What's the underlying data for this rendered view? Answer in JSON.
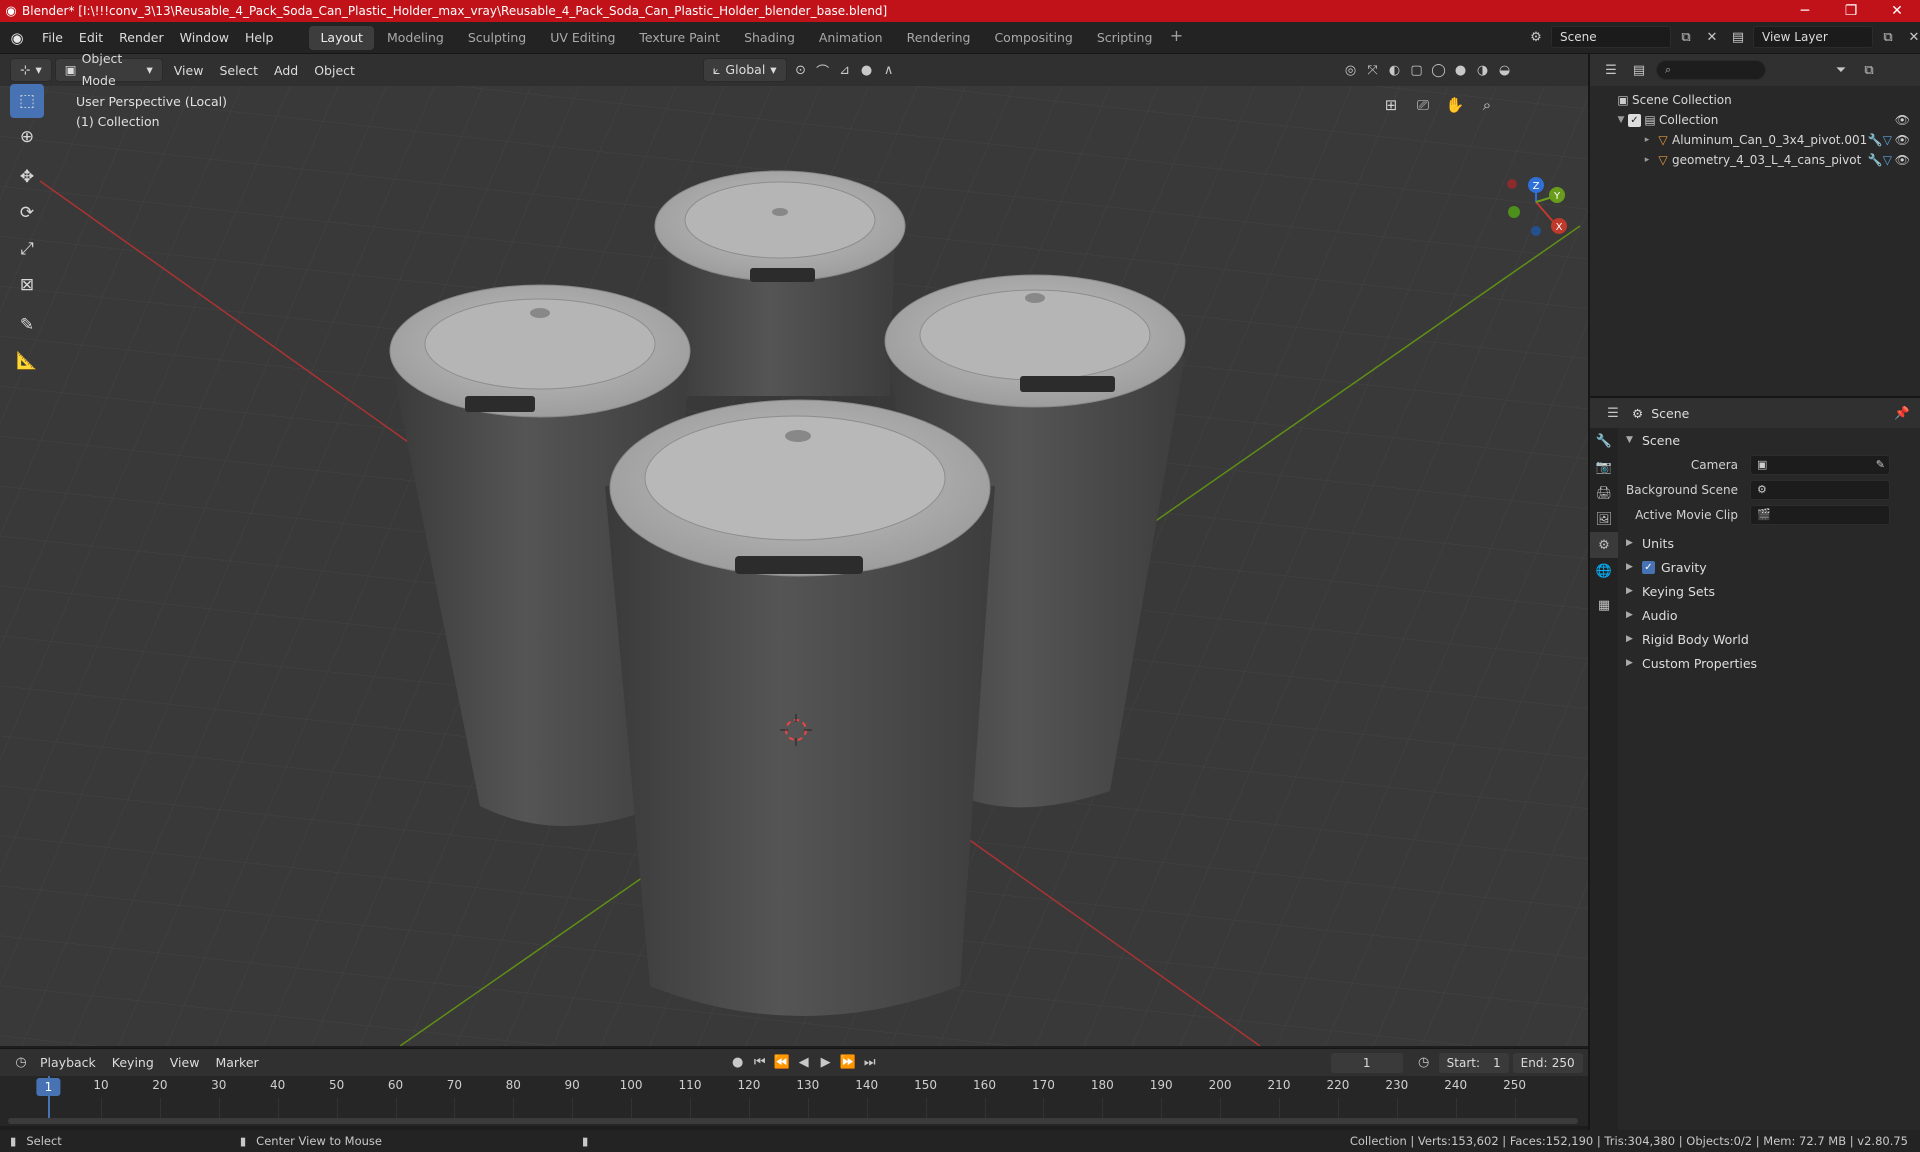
{
  "window": {
    "title": "Blender* [I:\\!!!conv_3\\13\\Reusable_4_Pack_Soda_Can_Plastic_Holder_max_vray\\Reusable_4_Pack_Soda_Can_Plastic_Holder_blender_base.blend]"
  },
  "menu": {
    "items": [
      "File",
      "Edit",
      "Render",
      "Window",
      "Help"
    ]
  },
  "workspaces": {
    "tabs": [
      "Layout",
      "Modeling",
      "Sculpting",
      "UV Editing",
      "Texture Paint",
      "Shading",
      "Animation",
      "Rendering",
      "Compositing",
      "Scripting"
    ],
    "active": "Layout"
  },
  "scene_selector": {
    "scene": "Scene",
    "view_layer": "View Layer"
  },
  "viewport_header": {
    "mode": "Object Mode",
    "menus": [
      "View",
      "Select",
      "Add",
      "Object"
    ],
    "orientation": "Global"
  },
  "viewport": {
    "perspective": "User Perspective (Local)",
    "collection": "(1) Collection",
    "gizmo": {
      "x": "X",
      "y": "Y",
      "z": "Z"
    }
  },
  "outliner": {
    "root": "Scene Collection",
    "collection": "Collection",
    "objects": [
      "Aluminum_Can_0_3x4_pivot.001",
      "geometry_4_03_L_4_cans_pivot"
    ]
  },
  "properties": {
    "header": "Scene",
    "panel": "Scene",
    "fields": [
      {
        "label": "Camera"
      },
      {
        "label": "Background Scene"
      },
      {
        "label": "Active Movie Clip"
      }
    ],
    "sections": [
      "Units",
      "Gravity",
      "Keying Sets",
      "Audio",
      "Rigid Body World",
      "Custom Properties"
    ]
  },
  "timeline": {
    "menus": [
      "Playback",
      "Keying",
      "View",
      "Marker"
    ],
    "current_frame": "1",
    "start_label": "Start:",
    "start": "1",
    "end_label": "End:",
    "end": "250",
    "ticks": [
      "10",
      "20",
      "30",
      "40",
      "50",
      "60",
      "70",
      "80",
      "90",
      "100",
      "110",
      "120",
      "130",
      "140",
      "150",
      "160",
      "170",
      "180",
      "190",
      "200",
      "210",
      "220",
      "230",
      "240",
      "250"
    ],
    "playhead_label": "1"
  },
  "statusbar": {
    "select": "Select",
    "center": "Center View to Mouse",
    "stats": "Collection | Verts:153,602 | Faces:152,190 | Tris:304,380 | Objects:0/2 | Mem: 72.7 MB | v2.80.75"
  },
  "colors": {
    "title_bar": "#c1121a",
    "accent": "#4772b3",
    "object_icon": "#e59a41",
    "axis_x": "#c0392b",
    "axis_y": "#6a9c1c",
    "axis_z": "#2f6fd6"
  }
}
